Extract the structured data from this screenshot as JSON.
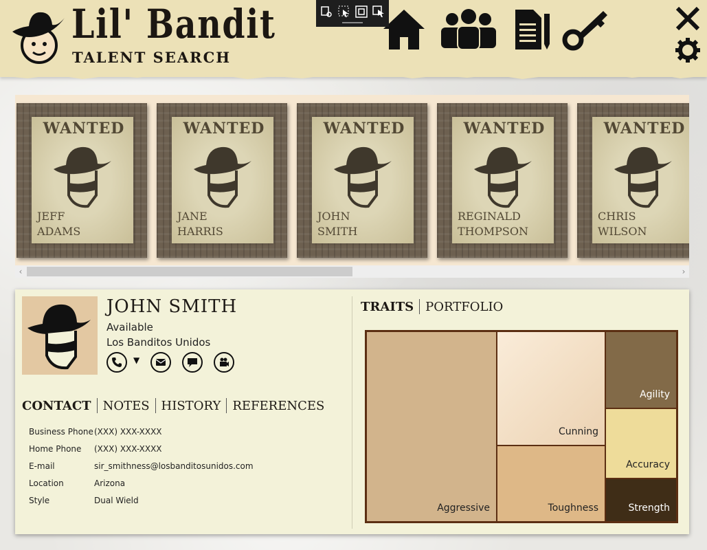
{
  "app": {
    "title": "Lil' Bandit",
    "subtitle": "TALENT SEARCH"
  },
  "nav": {
    "icons": [
      "home-icon",
      "people-icon",
      "document-icon",
      "key-icon"
    ]
  },
  "window_controls": [
    "close-icon",
    "gear-icon"
  ],
  "candidates": [
    {
      "wanted": "WANTED",
      "first": "JEFF",
      "last": "ADAMS"
    },
    {
      "wanted": "WANTED",
      "first": "JANE",
      "last": "HARRIS"
    },
    {
      "wanted": "WANTED",
      "first": "JOHN",
      "last": "SMITH"
    },
    {
      "wanted": "WANTED",
      "first": "REGINALD",
      "last": "THOMPSON"
    },
    {
      "wanted": "WANTED",
      "first": "CHRIS",
      "last": "WILSON"
    }
  ],
  "profile": {
    "name": "JOHN SMITH",
    "status": "Available",
    "organization": "Los Banditos Unidos",
    "actions": [
      "phone-icon",
      "mail-icon",
      "chat-icon",
      "video-icon"
    ]
  },
  "left_tabs": [
    "CONTACT",
    "NOTES",
    "HISTORY",
    "REFERENCES"
  ],
  "right_tabs": [
    "TRAITS",
    "PORTFOLIO"
  ],
  "contact": [
    {
      "label": "Business Phone",
      "value": "(XXX) XXX-XXXX"
    },
    {
      "label": "Home Phone",
      "value": "(XXX) XXX-XXXX"
    },
    {
      "label": "E-mail",
      "value": "sir_smithness@losbanditosunidos.com"
    },
    {
      "label": "Location",
      "value": "Arizona"
    },
    {
      "label": "Style",
      "value": "Dual Wield"
    }
  ],
  "traits": {
    "aggressive": "Aggressive",
    "cunning": "Cunning",
    "toughness": "Toughness",
    "agility": "Agility",
    "accuracy": "Accuracy",
    "strength": "Strength"
  },
  "colors": {
    "header": "#ece1b7",
    "panel": "#f3f2d9",
    "treemap_border": "#5b2e12",
    "aggressive": "#d2b48c",
    "cunning": "#f3dfc6",
    "toughness": "#deb887",
    "agility": "#826a48",
    "accuracy": "#eedc9a",
    "strength": "#3f2d17"
  }
}
